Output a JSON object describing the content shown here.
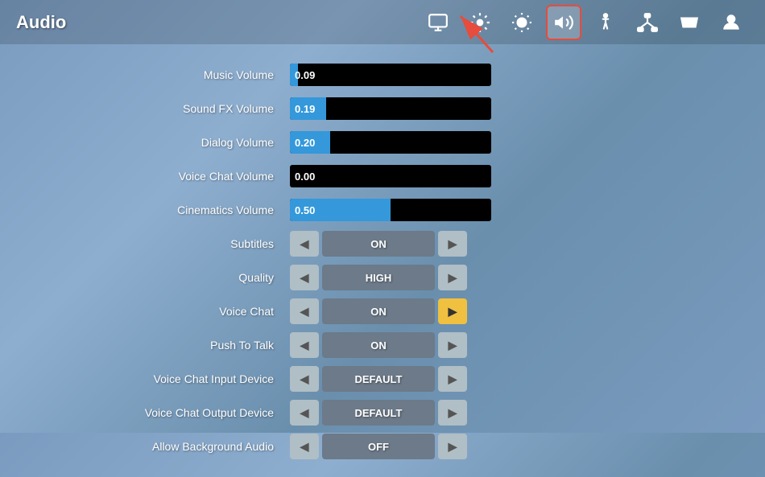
{
  "header": {
    "title": "Audio",
    "nav": [
      {
        "id": "monitor",
        "label": "Monitor",
        "symbol": "🖥",
        "active": false
      },
      {
        "id": "gear",
        "label": "Settings",
        "symbol": "⚙",
        "active": false
      },
      {
        "id": "brightness",
        "label": "Brightness",
        "symbol": "☀",
        "active": false
      },
      {
        "id": "audio",
        "label": "Audio",
        "symbol": "🔊",
        "active": true
      },
      {
        "id": "accessibility",
        "label": "Accessibility",
        "symbol": "♿",
        "active": false
      },
      {
        "id": "network",
        "label": "Network",
        "symbol": "📡",
        "active": false
      },
      {
        "id": "controller",
        "label": "Controller",
        "symbol": "🎮",
        "active": false
      },
      {
        "id": "account",
        "label": "Account",
        "symbol": "👤",
        "active": false
      }
    ]
  },
  "settings": [
    {
      "id": "music-volume",
      "label": "Music Volume",
      "type": "slider",
      "value": "0.09",
      "fill_percent": 4
    },
    {
      "id": "sound-fx-volume",
      "label": "Sound FX Volume",
      "type": "slider",
      "value": "0.19",
      "fill_percent": 18
    },
    {
      "id": "dialog-volume",
      "label": "Dialog Volume",
      "type": "slider",
      "value": "0.20",
      "fill_percent": 20
    },
    {
      "id": "voice-chat-volume",
      "label": "Voice Chat Volume",
      "type": "slider",
      "value": "0.00",
      "fill_percent": 0
    },
    {
      "id": "cinematics-volume",
      "label": "Cinematics Volume",
      "type": "slider",
      "value": "0.50",
      "fill_percent": 50
    },
    {
      "id": "subtitles",
      "label": "Subtitles",
      "type": "toggle",
      "value": "On",
      "right_btn_yellow": false
    },
    {
      "id": "quality",
      "label": "Quality",
      "type": "toggle",
      "value": "High",
      "right_btn_yellow": false
    },
    {
      "id": "voice-chat",
      "label": "Voice Chat",
      "type": "toggle",
      "value": "On",
      "right_btn_yellow": true
    },
    {
      "id": "push-to-talk",
      "label": "Push To Talk",
      "type": "toggle",
      "value": "On",
      "right_btn_yellow": false
    },
    {
      "id": "voice-chat-input",
      "label": "Voice Chat Input Device",
      "type": "toggle",
      "value": "DEFAULT",
      "right_btn_yellow": false
    },
    {
      "id": "voice-chat-output",
      "label": "Voice Chat Output Device",
      "type": "toggle",
      "value": "DEFAULT",
      "right_btn_yellow": false
    },
    {
      "id": "allow-bg-audio",
      "label": "Allow Background Audio",
      "type": "toggle",
      "value": "Off",
      "right_btn_yellow": false
    }
  ]
}
